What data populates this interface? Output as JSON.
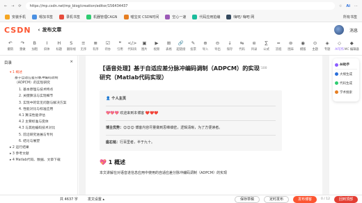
{
  "browser": {
    "url": "https://mp.csdn.net/mp_blog/creation/editor/156434437",
    "ai_label": "Ai",
    "bookmarks": [
      "安装手机",
      "嗯加书签",
      "录机书签",
      "机器管理CAGN",
      "喵宝买 CSDN时间",
      "空心一速",
      "代码应用拍编",
      "嗨吧/ 嗨吧 网"
    ],
    "bookmarks_right": "所有书签"
  },
  "header": {
    "logo_main": "CSDN",
    "post_title": "发布文章",
    "msg": "消息"
  },
  "toolbar": [
    {
      "glyph": "↶",
      "label": "撤销"
    },
    {
      "glyph": "↷",
      "label": "重做"
    },
    {
      "glyph": "B",
      "label": "加粗"
    },
    {
      "glyph": "I",
      "label": "斜体"
    },
    {
      "glyph": "H",
      "label": "标题"
    },
    {
      "glyph": "S",
      "label": "删除线"
    },
    {
      "glyph": "≡",
      "label": "无序"
    },
    {
      "glyph": "≣",
      "label": "有序"
    },
    {
      "glyph": "☑",
      "label": "待办"
    },
    {
      "glyph": "❝",
      "label": "引用"
    },
    {
      "glyph": "</>",
      "label": "代码块"
    },
    {
      "glyph": "▣",
      "label": "图片"
    },
    {
      "glyph": "▶",
      "label": "视频"
    },
    {
      "glyph": "⊞",
      "label": "表格"
    },
    {
      "glyph": "🔗",
      "label": "超链接"
    },
    {
      "glyph": "✎",
      "label": "投票"
    },
    {
      "glyph": "⊕",
      "label": "导入"
    },
    {
      "glyph": "⊖",
      "label": "导出"
    },
    {
      "glyph": "↓",
      "label": "保存"
    },
    {
      "glyph": "⇆",
      "label": "代码"
    },
    {
      "glyph": "⊜",
      "label": "目录"
    },
    {
      "glyph": "∑",
      "label": "公式"
    },
    {
      "glyph": "≈",
      "label": "流程"
    },
    {
      "glyph": "⊚",
      "label": "图床"
    },
    {
      "glyph": "◉",
      "label": "模版"
    },
    {
      "glyph": "⊙",
      "label": "主题"
    },
    {
      "glyph": "◈",
      "label": "专题"
    },
    {
      "glyph": "◇",
      "label": "AI写作"
    },
    {
      "glyph": "◆",
      "label": "MC 编辑器"
    }
  ],
  "outline": {
    "title": "目录",
    "collapse": "×",
    "items": [
      {
        "text": "▾ 1 概述",
        "level": "l1",
        "active": true
      },
      {
        "text": "基于自适应差分脉冲编码调制（ADPCM）的实现研究",
        "level": "l2",
        "wrap": true
      },
      {
        "text": "1. 基本原理与技术特点",
        "level": "l3"
      },
      {
        "text": "2. 关键算法与实现细节",
        "level": "l3"
      },
      {
        "text": "3. 实现中的常见问题与解决方案",
        "level": "l3"
      },
      {
        "text": "4. 性能对比与标准应用",
        "level": "l3"
      },
      {
        "text": "4.1 算法性能评估",
        "level": "l3"
      },
      {
        "text": "4.2 主要标准与变体",
        "level": "l3"
      },
      {
        "text": "4.3 与其他编码技术对比",
        "level": "l3"
      },
      {
        "text": "5. 前沿研究进展与专利",
        "level": "l3"
      },
      {
        "text": "6. 结论与展望",
        "level": "l3"
      },
      {
        "text": "▸ 2 运行结果",
        "level": "l1"
      },
      {
        "text": "▸ 3 参考文献",
        "level": "l1"
      },
      {
        "text": "▸ 4 Matlab代码、数据、文章下载",
        "level": "l1"
      }
    ]
  },
  "article": {
    "title": "【语音处理】基于自适应差分脉冲编码调制（ADPCM）的实现研究（Matlab代码实现）",
    "title_icon": "⊞",
    "count": "43 / 100",
    "card_heading": "👤 个人主页",
    "welcome": "💖💖💖 欢迎来到本博客 ❤️❤️❤️",
    "advantage_label": "博主优势：",
    "advantage_text": "😊😊😊 博客内容尽量做到思维缜密，逻辑清晰，为了方便读者。",
    "motto_label": "座右铭：",
    "motto_text": "行百里者，半于九十。",
    "section_heading": "💖 1 概述",
    "body": "本文讲解在对语音进信息应用中使用的自适应差分脉冲编码调制（ADPCM）的实现"
  },
  "ai_panel": {
    "title": "AI助手",
    "items": [
      "大纲生成",
      "代码生成",
      "学术搜索"
    ]
  },
  "footer": {
    "words_label": "共 4637 字",
    "dir_label": "发文设置",
    "dir_caret": "▴",
    "save": "保存草稿",
    "timer": "定时发布",
    "publish": "发布博客",
    "pages": "0 / 12",
    "go": "回到顶部"
  }
}
